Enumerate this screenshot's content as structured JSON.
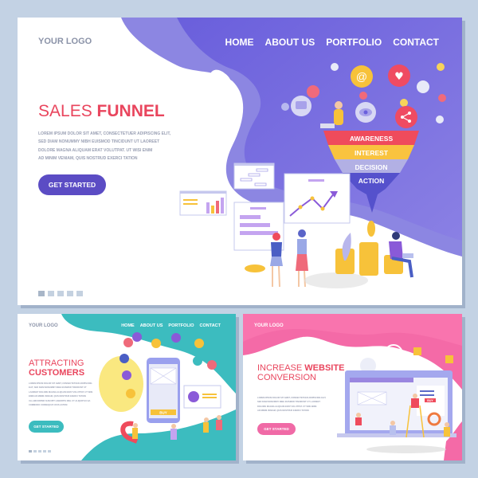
{
  "main": {
    "logo": "YOUR LOGO",
    "nav": [
      "HOME",
      "ABOUT US",
      "PORTFOLIO",
      "CONTACT"
    ],
    "title_thin": "SALES ",
    "title_bold": "FUNNEL",
    "body_lines": [
      "LOREM IPSUM DOLOR SIT AMET, CONSECTETUER ADIPISCING ELIT,",
      "SED DIAM NONUMMY NIBH EUISMOD TINCIDUNT UT LAOREET",
      "DOLORE MAGNA ALIQUAM ERAT VOLUTPAT. UT WISI ENIM",
      "AD MINIM VENIAM, QUIS NOSTRUD EXERCI TATION"
    ],
    "cta": "GET STARTED",
    "funnel": [
      "AWARENESS",
      "INTEREST",
      "DECISION",
      "ACTION"
    ],
    "pagination_count": 5,
    "pagination_active": 1,
    "colors": {
      "accent": "#5b4cc4",
      "title": "#e9455d",
      "blob": "#6b5fd8"
    }
  },
  "left": {
    "logo": "YOUR LOGO",
    "nav": [
      "HOME",
      "ABOUT US",
      "PORTFOLIO",
      "CONTACT"
    ],
    "title_line1": "ATTRACTING",
    "title_line2": "CUSTOMERS",
    "body_lines": [
      "LOREM IPSUM DOLOR SIT AMET, CONSECTETUER ADIPISCING",
      "ELIT, SED DIAM NONUMMY NIBH EUISMOD TINCIDUNT UT",
      "LAOREET DOLORE MAGNA ALIQUAM ERAT VOLUTPAT. UT WISI",
      "ENIM AD MINIM VENIAM, QUIS NOSTRUD EXERCI TATION",
      "ULLAMCORPER SUSCIPIT LOBORTIS NISL UT ALIQUIP EX EA",
      "COMMODO CONSEQUAT. DUIS AUTEM"
    ],
    "cta": "GET STARTED",
    "phone_button": "BUY",
    "colors": {
      "accent": "#3cbcbf"
    }
  },
  "right": {
    "logo": "YOUR LOGO",
    "title_thin": "INCREASE ",
    "title_bold": "WEBSITE",
    "title_line2": "CONVERSION",
    "body_lines": [
      "LOREM IPSUM DOLOR SIT AMET, CONSECTETUER ADIPISCING ELIT,",
      "SED DIAM NONUMMY NIBH EUISMOD TINCIDUNT UT LAOREET",
      "DOLORE MAGNA ALIQUAM ERAT VOLUTPAT. UT WISI ENIM",
      "AD MINIM VENIAM, QUIS NOSTRUD EXERCI TATION"
    ],
    "cta": "GET STARTED",
    "screen_button": "BUY",
    "colors": {
      "accent": "#f06aa6"
    }
  }
}
